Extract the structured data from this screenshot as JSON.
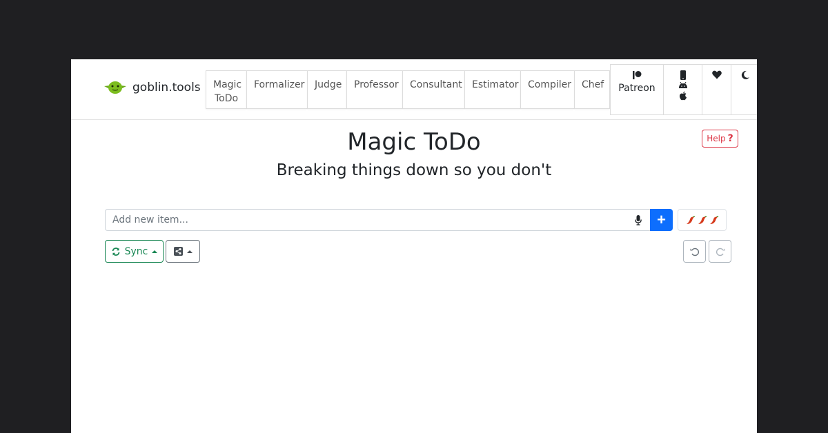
{
  "brand": {
    "name": "goblin.tools"
  },
  "nav": {
    "tabs": [
      {
        "line1": "Magic",
        "line2": "ToDo"
      },
      {
        "line1": "Formalizer",
        "line2": ""
      },
      {
        "line1": "Judge",
        "line2": ""
      },
      {
        "line1": "Professor",
        "line2": ""
      },
      {
        "line1": "Consultant",
        "line2": ""
      },
      {
        "line1": "Estimator",
        "line2": ""
      },
      {
        "line1": "Compiler",
        "line2": ""
      },
      {
        "line1": "Chef",
        "line2": ""
      }
    ],
    "patreon_label": "Patreon"
  },
  "header": {
    "title": "Magic ToDo",
    "subtitle": "Breaking things down so you don't"
  },
  "help": {
    "label": "Help",
    "mark": "?"
  },
  "input": {
    "placeholder": "Add new item...",
    "add_symbol": "+"
  },
  "spice": {
    "level": 3,
    "icons": [
      "chili-icon",
      "chili-icon",
      "chili-icon"
    ]
  },
  "toolbar": {
    "sync_label": "Sync"
  },
  "colors": {
    "primary": "#0d6efd",
    "success": "#198754",
    "danger": "#dc3545",
    "goblin_green": "#7cbd1e"
  }
}
